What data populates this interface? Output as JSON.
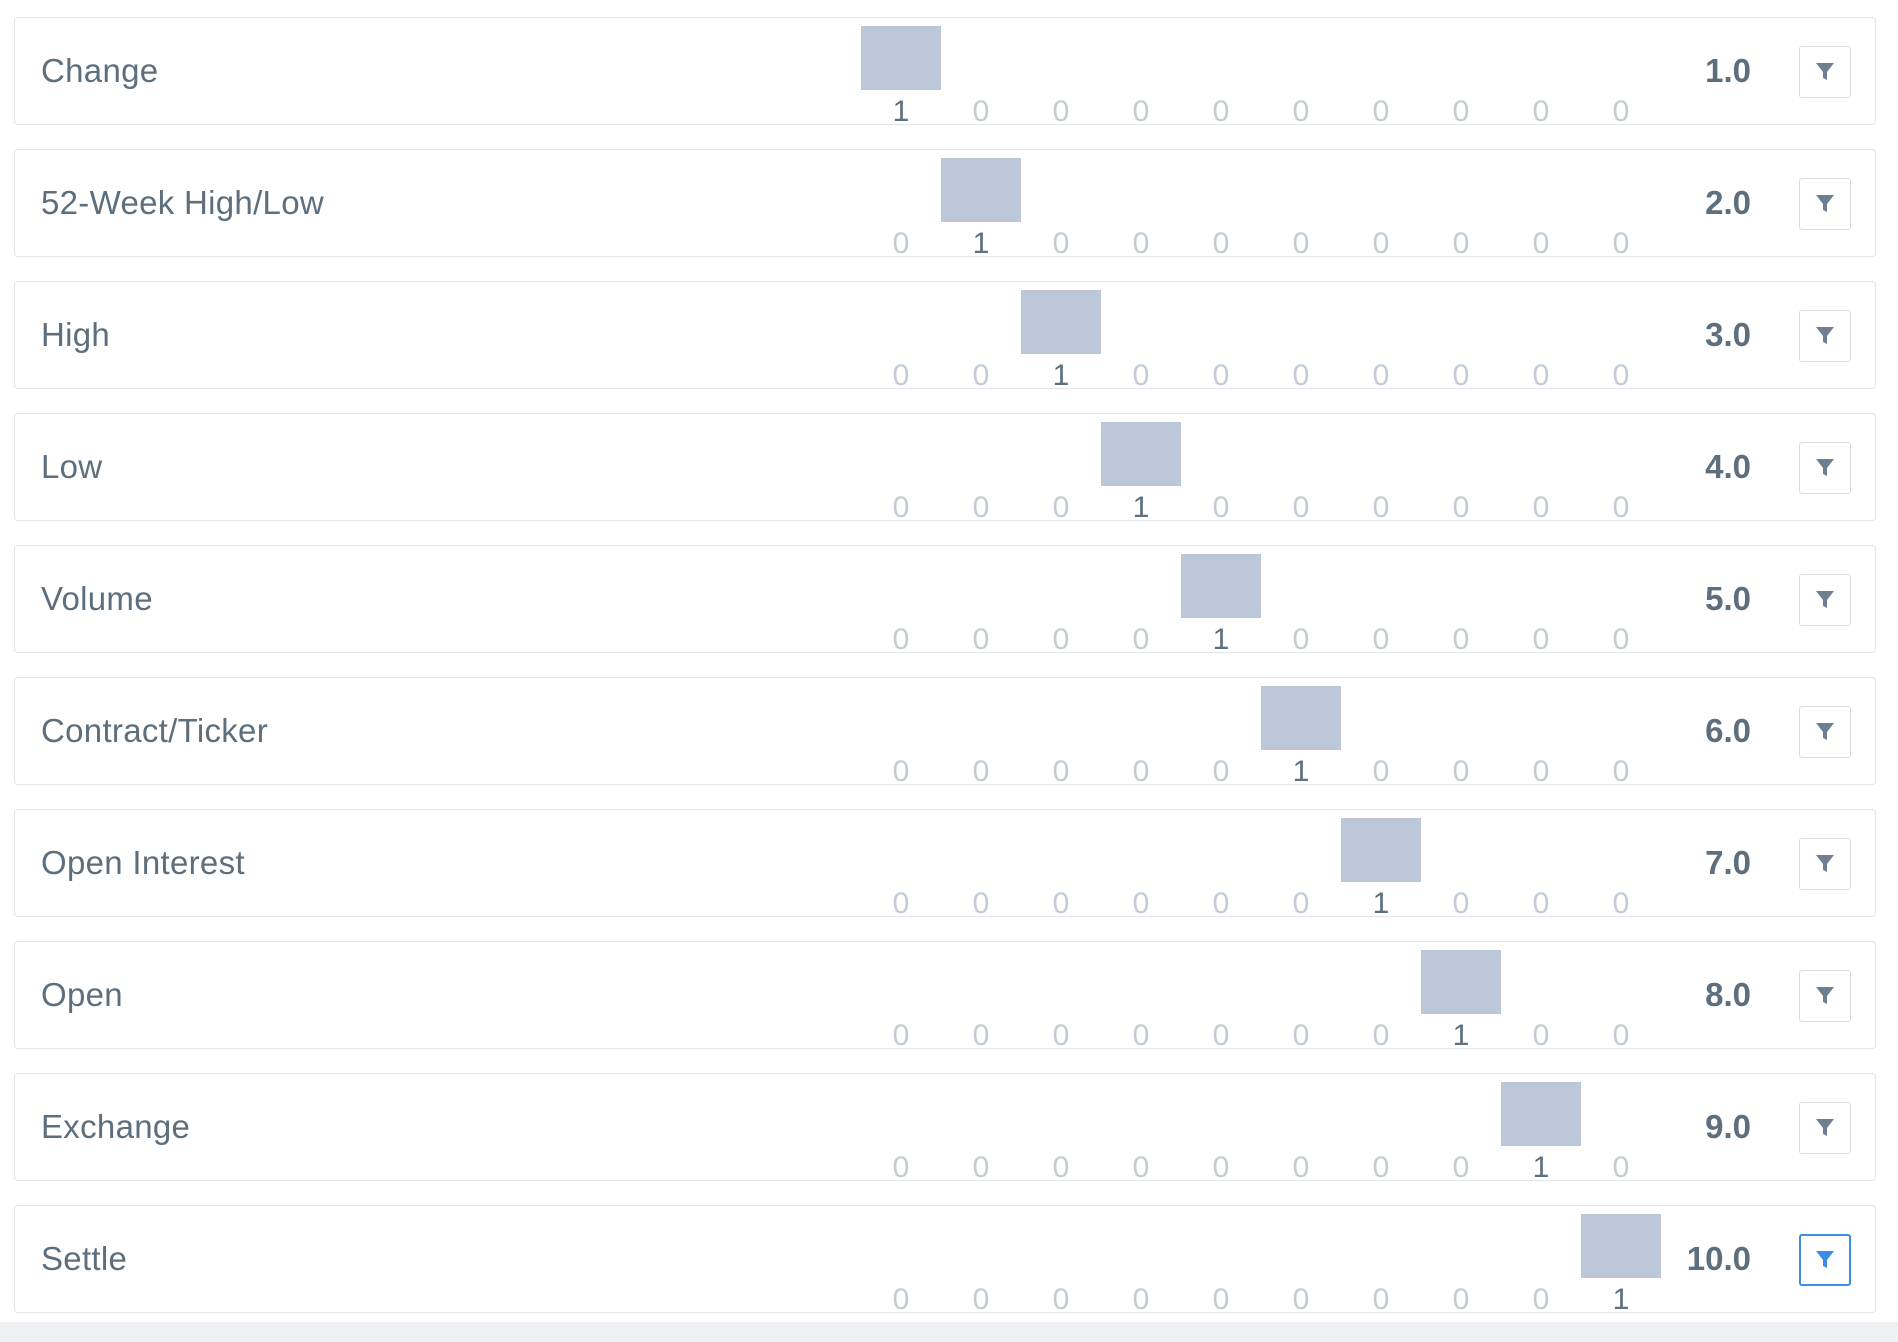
{
  "rows": [
    {
      "label": "Change",
      "value": "1.0",
      "active_bin": 0,
      "counts": [
        "1",
        "0",
        "0",
        "0",
        "0",
        "0",
        "0",
        "0",
        "0",
        "0"
      ],
      "filter_active": false
    },
    {
      "label": "52-Week High/Low",
      "value": "2.0",
      "active_bin": 1,
      "counts": [
        "0",
        "1",
        "0",
        "0",
        "0",
        "0",
        "0",
        "0",
        "0",
        "0"
      ],
      "filter_active": false
    },
    {
      "label": "High",
      "value": "3.0",
      "active_bin": 2,
      "counts": [
        "0",
        "0",
        "1",
        "0",
        "0",
        "0",
        "0",
        "0",
        "0",
        "0"
      ],
      "filter_active": false
    },
    {
      "label": "Low",
      "value": "4.0",
      "active_bin": 3,
      "counts": [
        "0",
        "0",
        "0",
        "1",
        "0",
        "0",
        "0",
        "0",
        "0",
        "0"
      ],
      "filter_active": false
    },
    {
      "label": "Volume",
      "value": "5.0",
      "active_bin": 4,
      "counts": [
        "0",
        "0",
        "0",
        "0",
        "1",
        "0",
        "0",
        "0",
        "0",
        "0"
      ],
      "filter_active": false
    },
    {
      "label": "Contract/Ticker",
      "value": "6.0",
      "active_bin": 5,
      "counts": [
        "0",
        "0",
        "0",
        "0",
        "0",
        "1",
        "0",
        "0",
        "0",
        "0"
      ],
      "filter_active": false
    },
    {
      "label": "Open Interest",
      "value": "7.0",
      "active_bin": 6,
      "counts": [
        "0",
        "0",
        "0",
        "0",
        "0",
        "0",
        "1",
        "0",
        "0",
        "0"
      ],
      "filter_active": false
    },
    {
      "label": "Open",
      "value": "8.0",
      "active_bin": 7,
      "counts": [
        "0",
        "0",
        "0",
        "0",
        "0",
        "0",
        "0",
        "1",
        "0",
        "0"
      ],
      "filter_active": false
    },
    {
      "label": "Exchange",
      "value": "9.0",
      "active_bin": 8,
      "counts": [
        "0",
        "0",
        "0",
        "0",
        "0",
        "0",
        "0",
        "0",
        "1",
        "0"
      ],
      "filter_active": false
    },
    {
      "label": "Settle",
      "value": "10.0",
      "active_bin": 9,
      "counts": [
        "0",
        "0",
        "0",
        "0",
        "0",
        "0",
        "0",
        "0",
        "0",
        "1"
      ],
      "filter_active": true
    }
  ],
  "icons": {
    "filter": "filter-funnel-icon"
  },
  "colors": {
    "bar": "#bcc8d9",
    "text": "#5d6e7d",
    "count_muted": "#c2ccd6",
    "filter_active": "#3d8de6"
  }
}
